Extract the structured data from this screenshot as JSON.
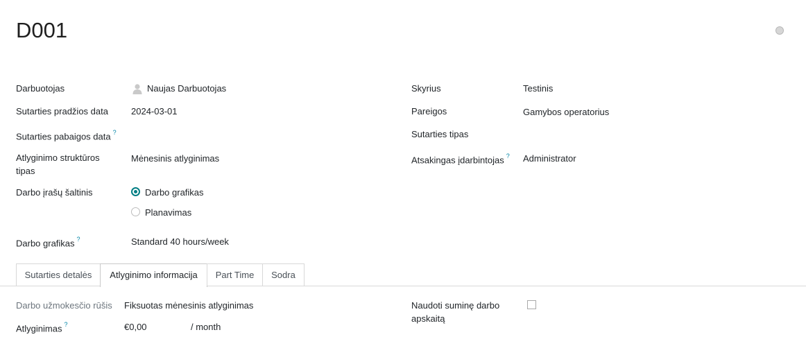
{
  "record": {
    "title": "D001"
  },
  "left_fields": {
    "employee_label": "Darbuotojas",
    "employee_value": "Naujas Darbuotojas",
    "start_label": "Sutarties pradžios data",
    "start_value": "2024-03-01",
    "end_label": "Sutarties pabaigos data",
    "salary_structure_label_1": "Atlyginimo struktūros",
    "salary_structure_label_2": "tipas",
    "salary_structure_value": "Mėnesinis atlyginimas",
    "work_source_label": "Darbo įrašų šaltinis",
    "work_source_options": [
      "Darbo grafikas",
      "Planavimas"
    ],
    "work_source_selected": "Darbo grafikas",
    "schedule_label": "Darbo grafikas",
    "schedule_value": "Standard 40 hours/week"
  },
  "right_fields": {
    "department_label": "Skyrius",
    "department_value": "Testinis",
    "position_label": "Pareigos",
    "position_value": "Gamybos operatorius",
    "contract_type_label": "Sutarties tipas",
    "responsible_label": "Atsakingas įdarbintojas",
    "responsible_value": "Administrator"
  },
  "help_marker": "?",
  "tabs": [
    "Sutarties detalės",
    "Atlyginimo informacija",
    "Part Time",
    "Sodra"
  ],
  "active_tab": "Atlyginimo informacija",
  "salary_tab": {
    "wage_type_label": "Darbo užmokesčio rūšis",
    "wage_type_value": "Fiksuotas mėnesinis atlyginimas",
    "wage_label": "Atlyginimas",
    "wage_value": "€0,00",
    "wage_period": "/ month",
    "cumulative_label_1": "Naudoti suminę darbo",
    "cumulative_label_2": "apskaitą",
    "cumulative_checked": false
  },
  "colors": {
    "accent": "#017e84",
    "help": "#0184a6"
  }
}
